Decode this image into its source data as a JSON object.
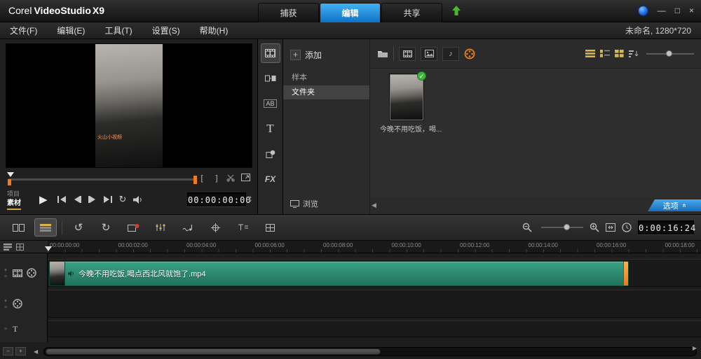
{
  "colors": {
    "accent_blue": "#1e9be8",
    "clip_teal": "#2f8f78",
    "marker_orange": "#f07a1e",
    "highlight_yellow": "#d8b64a",
    "check_green": "#3db53a"
  },
  "icons": {
    "minimize": "—",
    "maximize": "□",
    "close": "×",
    "add_plus": "+",
    "play": "▶",
    "loop": "↻",
    "undo": "↺",
    "redo": "↻",
    "trim_in": "[",
    "trim_out": "]",
    "collapse_left": "◀",
    "scroll_left": "◀",
    "scroll_right": "▶",
    "options_chevrons": "«",
    "music_note": "♪",
    "rail_title_ab": "AB",
    "rail_title_t": "T",
    "rail_fx": "FX",
    "track_title_t": "T",
    "stepper_up": "▲",
    "stepper_down": "▼",
    "track_minus": "−",
    "track_plus": "+"
  },
  "titlebar": {
    "brand_prefix": "Corel",
    "brand_product": "VideoStudio",
    "brand_version": "X9",
    "tabs": [
      {
        "label": "捕获",
        "active": false
      },
      {
        "label": "编辑",
        "active": true
      },
      {
        "label": "共享",
        "active": false
      }
    ]
  },
  "menubar": {
    "items": [
      "文件(F)",
      "编辑(E)",
      "工具(T)",
      "设置(S)",
      "帮助(H)"
    ],
    "project_name": "未命名, 1280*720"
  },
  "preview": {
    "watermark": "火山小视频",
    "project_label": "项目",
    "clip_label": "素材",
    "timecode": "00:00:00:00"
  },
  "library": {
    "add_label": "添加",
    "samples_label": "样本",
    "folder_label": "文件夹",
    "browse_label": "浏览",
    "options_label": "选项",
    "items": [
      {
        "caption": "今晚不用吃饭，喝..."
      }
    ]
  },
  "toolbar": {
    "timecode": "0:00:16:24"
  },
  "timeline": {
    "ruler_ticks": [
      "00:00:00:00",
      "00:00:02:00",
      "00:00:04:00",
      "00:00:06:00",
      "00:00:08:00",
      "00:00:10:00",
      "00:00:12:00",
      "00:00:14:00",
      "00:00:16:00",
      "00:00:18:00"
    ],
    "clip_name": "今晚不用吃饭,喝点西北风就饱了.mp4"
  }
}
